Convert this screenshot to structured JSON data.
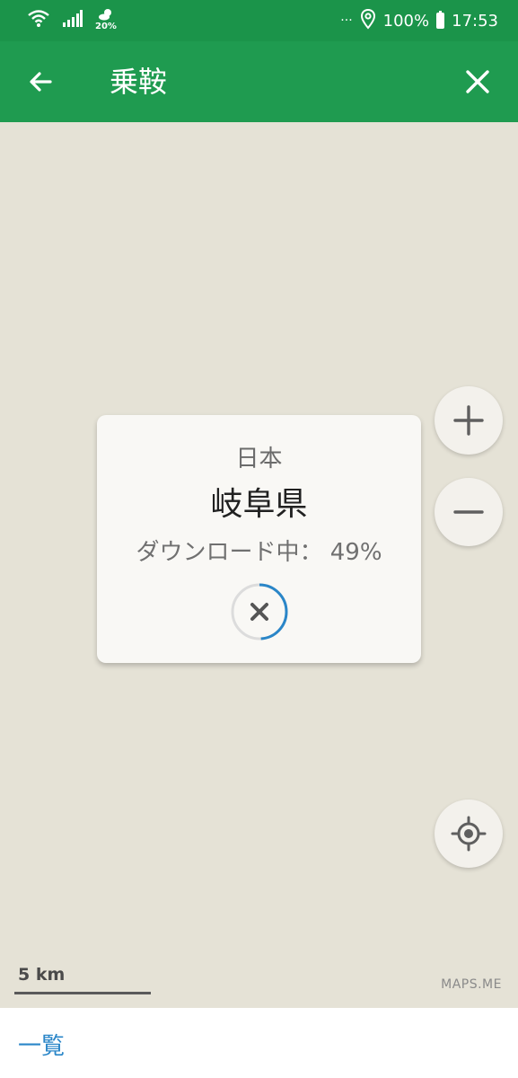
{
  "status_bar": {
    "weather_temp": "20%",
    "overflow": "···",
    "battery": "100%",
    "time": "17:53"
  },
  "app_bar": {
    "title": "乗鞍"
  },
  "download_card": {
    "country": "日本",
    "region": "岐阜県",
    "status": "ダウンロード中： 49%",
    "progress_fraction": 0.49
  },
  "map": {
    "scale_label": "5 km",
    "brand": "MAPS.ME"
  },
  "bottom_bar": {
    "list_label": "一覧"
  },
  "colors": {
    "status_bar_bg": "#1b944a",
    "app_bar_bg": "#1f9b50",
    "map_bg": "#e5e2d6",
    "progress_accent": "#2a86c8",
    "link": "#2a86c8"
  },
  "icons": [
    "wifi-icon",
    "signal-icon",
    "weather-icon",
    "location-pin-icon",
    "battery-icon",
    "back-arrow-icon",
    "close-icon",
    "plus-icon",
    "minus-icon",
    "my-location-icon",
    "cancel-download-icon"
  ]
}
